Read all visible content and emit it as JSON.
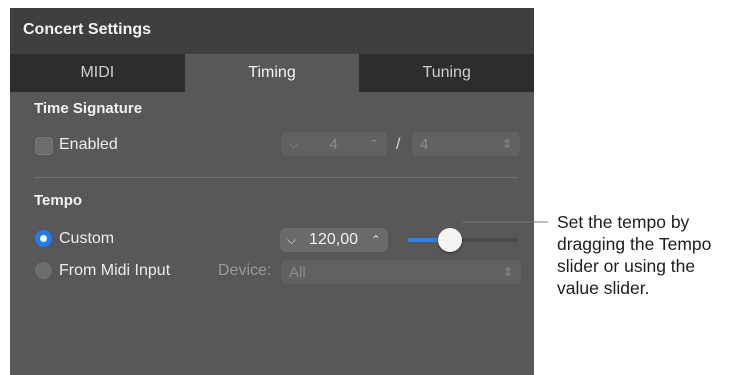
{
  "window": {
    "title": "Concert Settings"
  },
  "tabs": [
    {
      "label": "MIDI"
    },
    {
      "label": "Timing"
    },
    {
      "label": "Tuning"
    }
  ],
  "time_signature": {
    "title": "Time Signature",
    "enabled_label": "Enabled",
    "enabled": false,
    "numerator": "4",
    "separator": "/",
    "denominator": "4"
  },
  "tempo": {
    "title": "Tempo",
    "custom_label": "Custom",
    "from_midi_label": "From Midi Input",
    "device_label": "Device:",
    "device_value": "All",
    "value": "120,00",
    "slider_fraction": 0.38
  },
  "callout": {
    "text": "Set the tempo by dragging the Tempo slider or using the value slider."
  },
  "icons": {
    "down": "⌵",
    "up": "⌃",
    "updown": "⇕"
  },
  "colors": {
    "accent": "#2b7ef0",
    "panel": "#585858",
    "header": "#3f3f3f"
  }
}
